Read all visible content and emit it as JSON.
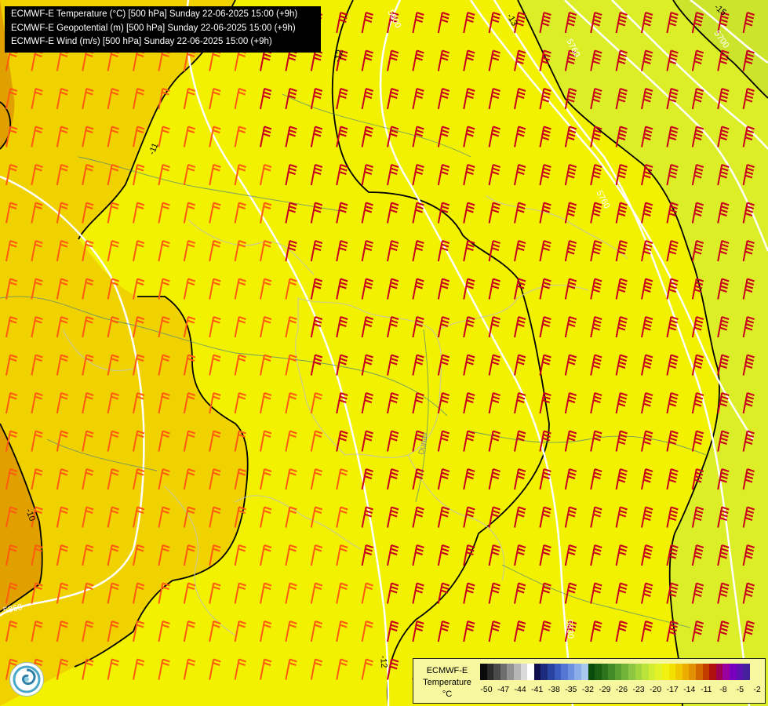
{
  "header": {
    "lines": [
      "ECMWF-E Temperature (°C) [500 hPa] Sunday 22-06-2025 15:00 (+9h)",
      "ECMWF-E Geopotential (m) [500 hPa] Sunday 22-06-2025 15:00 (+9h)",
      "ECMWF-E Wind (m/s) [500 hPa] Sunday 22-06-2025 15:00 (+9h)"
    ]
  },
  "legend": {
    "title_line1": "ECMWF-E",
    "title_line2": "Temperature",
    "unit": "°C",
    "ticks": [
      "-50",
      "-47",
      "-44",
      "-41",
      "-38",
      "-35",
      "-32",
      "-29",
      "-26",
      "-23",
      "-20",
      "-17",
      "-14",
      "-11",
      "-8",
      "-5",
      "-2"
    ],
    "colors": [
      "#0a0a0a",
      "#2a2a2a",
      "#4a4a4a",
      "#6e6e6e",
      "#929292",
      "#b6b6b6",
      "#dadada",
      "#ffffff",
      "#101050",
      "#1c2c7c",
      "#2a43a0",
      "#3c5bbf",
      "#5476d4",
      "#6f92e0",
      "#8caee8",
      "#a8c8f0",
      "#0a4a0a",
      "#1a5e12",
      "#2e741c",
      "#448a26",
      "#5aa030",
      "#72b43a",
      "#8cc642",
      "#a4d640",
      "#bce23c",
      "#d2ec30",
      "#e4f228",
      "#f2f210",
      "#f2e000",
      "#f0c800",
      "#eaad00",
      "#e09000",
      "#d46800",
      "#c23c00",
      "#b01010",
      "#a00050",
      "#9a00a0",
      "#7a00c0",
      "#5c10b0",
      "#44209a"
    ]
  },
  "map": {
    "temperature_contour_labels": [
      "-10",
      "-11",
      "-12",
      "-12",
      "-13",
      "-15"
    ],
    "geopotential_contour_labels": [
      "5860",
      "5800",
      "5760",
      "5760",
      "5700",
      "5830"
    ],
    "river_label": "Dunav",
    "fill_colors": {
      "yellow": "#f2f200",
      "light_orange": "#f0d200",
      "orange": "#eab800",
      "dark_orange": "#e0a000",
      "green_yellow": "#dcee28",
      "lime": "#cce52c"
    },
    "wind_barb_colors": {
      "orange": "#ff5a10",
      "red": "#c8001e"
    }
  }
}
